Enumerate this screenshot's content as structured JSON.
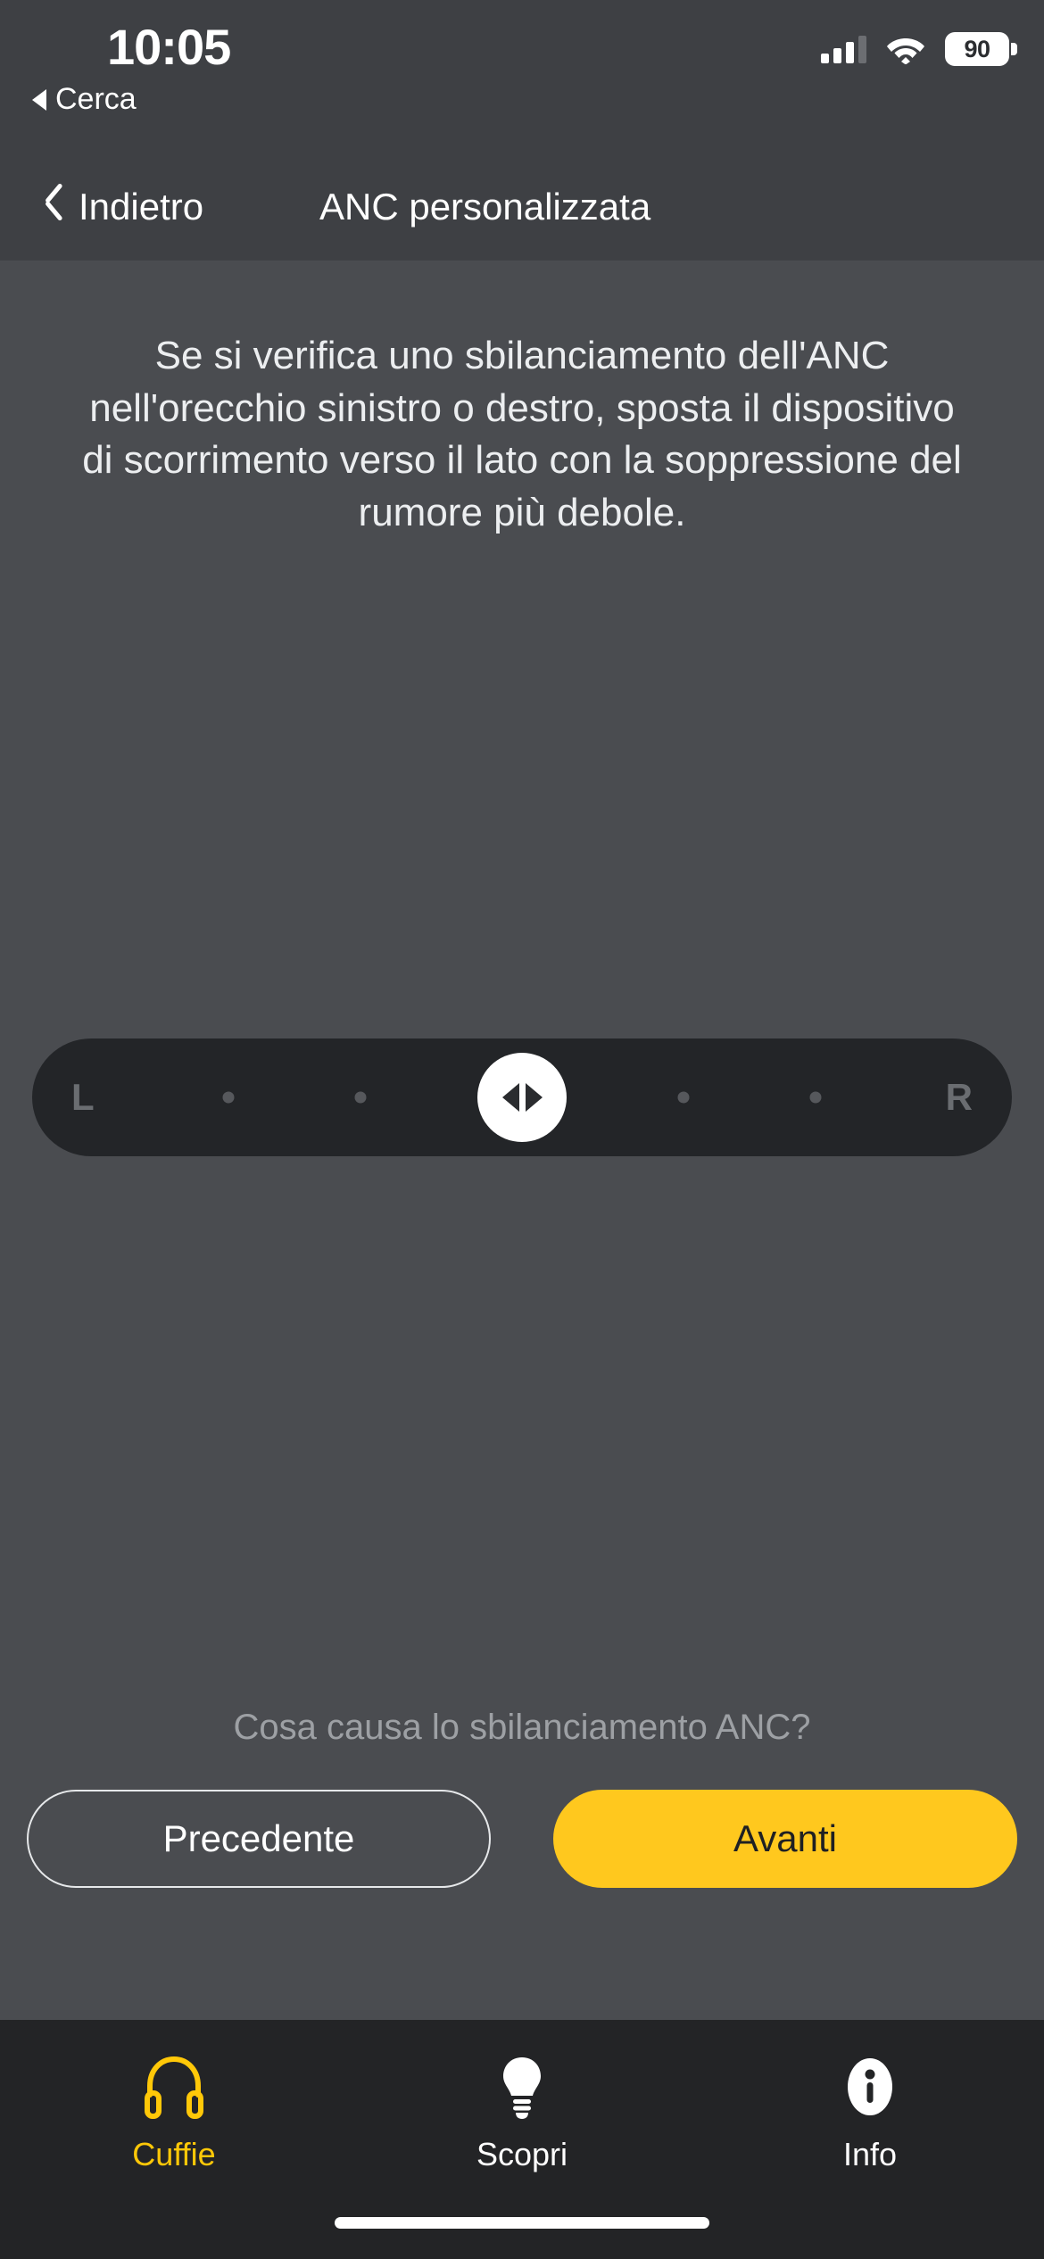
{
  "status_bar": {
    "time": "10:05",
    "return_app_label": "Cerca",
    "return_arrow_icon": "triangle-left-icon",
    "signal_icon": "cellular-signal-icon",
    "signal_bars_filled": 3,
    "signal_bars_total": 4,
    "wifi_icon": "wifi-icon",
    "battery_icon": "battery-icon",
    "battery_level": "90"
  },
  "nav": {
    "back_icon": "chevron-left-icon",
    "back_label": "Indietro",
    "title": "ANC personalizzata"
  },
  "main": {
    "instruction": "Se si verifica uno sbilanciamento dell'ANC nell'orecchio sinistro o destro, sposta il dispositivo di scorrimento verso il lato con la soppressione del rumore più debole.",
    "slider": {
      "name": "anc-balance-slider",
      "left_label": "L",
      "right_label": "R",
      "thumb_icon": "left-right-arrows-icon",
      "value_percent": 50,
      "tick_positions_percent": [
        20,
        33,
        67,
        80
      ]
    },
    "help_question": "Cosa causa lo sbilanciamento ANC?",
    "buttons": {
      "previous_label": "Precedente",
      "next_label": "Avanti"
    }
  },
  "tab_bar": {
    "items": [
      {
        "label": "Cuffie",
        "icon": "headphones-icon",
        "active": true
      },
      {
        "label": "Scopri",
        "icon": "lightbulb-icon",
        "active": false
      },
      {
        "label": "Info",
        "icon": "info-circle-icon",
        "active": false
      }
    ]
  },
  "colors": {
    "accent_yellow": "#FFC81E",
    "tab_active_yellow": "#FFC808",
    "background": "#4A4C50",
    "chrome": "#3E4044",
    "tabbar_background": "#232426",
    "slider_track": "#232528"
  }
}
